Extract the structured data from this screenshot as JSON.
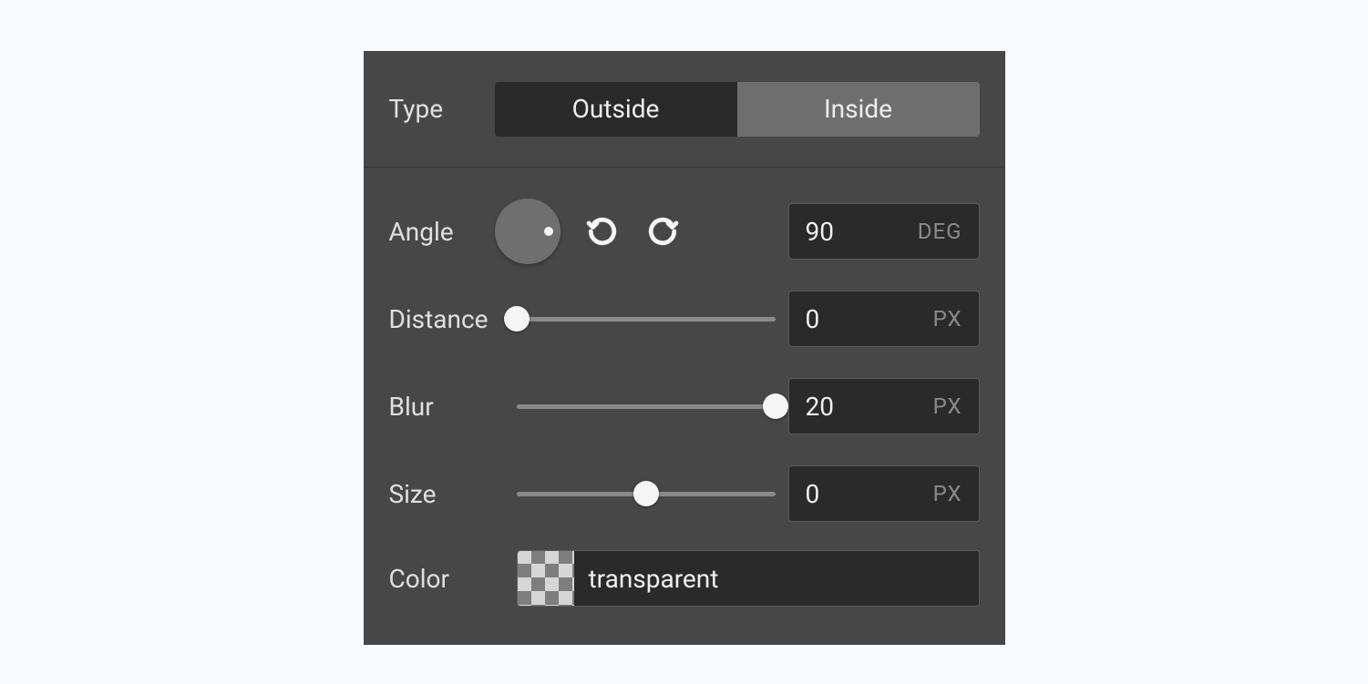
{
  "type": {
    "label": "Type",
    "options": [
      "Outside",
      "Inside"
    ],
    "selected": "Inside"
  },
  "angle": {
    "label": "Angle",
    "value": "90",
    "unit": "DEG"
  },
  "distance": {
    "label": "Distance",
    "value": "0",
    "unit": "PX",
    "slider_percent": 0
  },
  "blur": {
    "label": "Blur",
    "value": "20",
    "unit": "PX",
    "slider_percent": 100
  },
  "size": {
    "label": "Size",
    "value": "0",
    "unit": "PX",
    "slider_percent": 50
  },
  "color": {
    "label": "Color",
    "value": "transparent"
  }
}
